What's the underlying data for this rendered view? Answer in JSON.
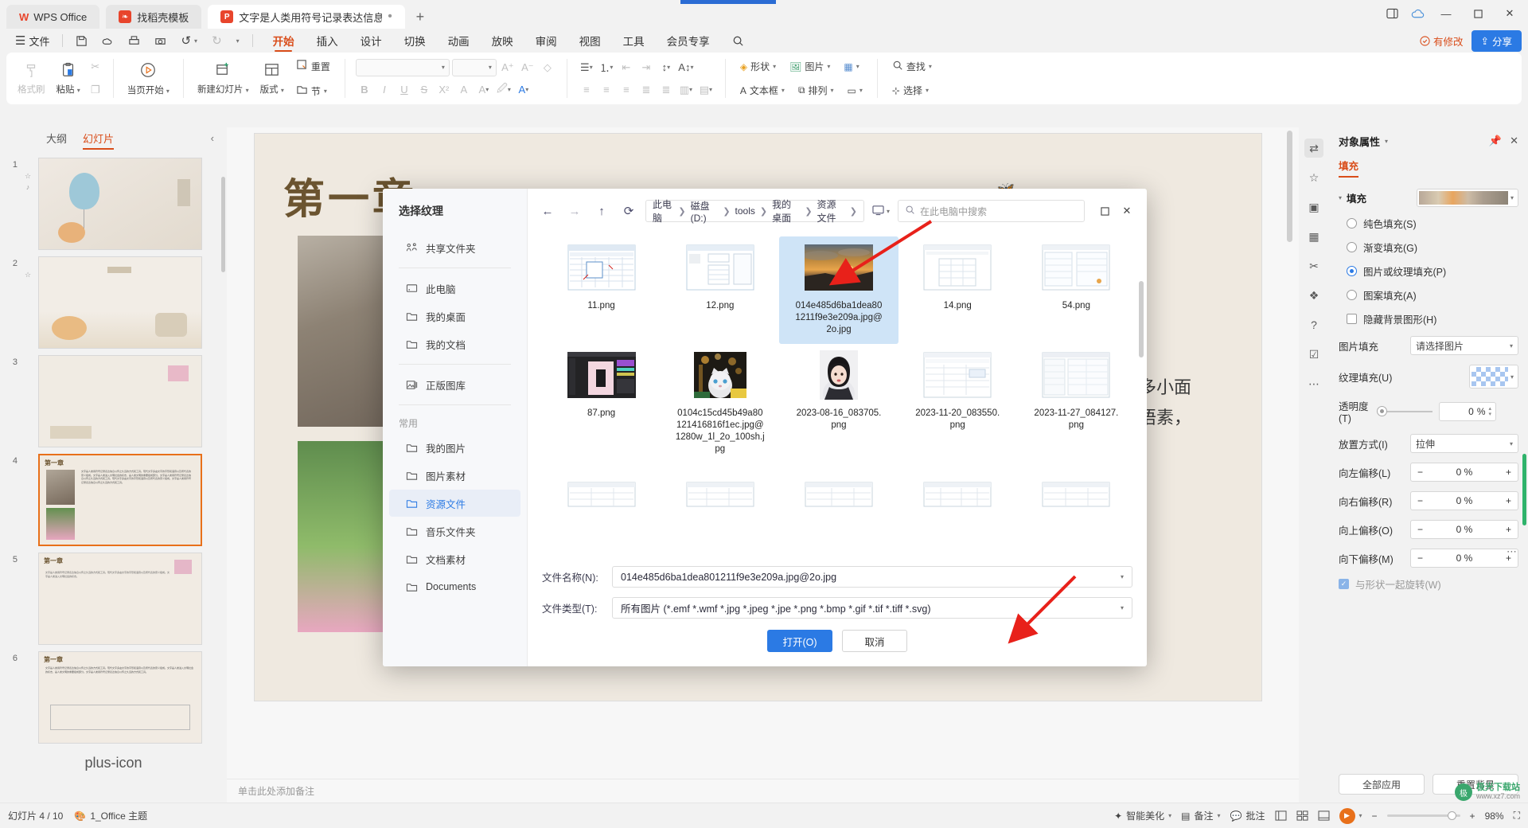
{
  "titlebar": {
    "tabs": [
      {
        "label": "WPS Office",
        "icon": "wps-logo-icon",
        "active": false
      },
      {
        "label": "找稻壳模板",
        "icon": "daoke-icon",
        "active": false
      },
      {
        "label": "文字是人类用符号记录表达信息以…",
        "icon": "ppt-file-icon",
        "active": true
      }
    ],
    "new_tab": "+",
    "window_controls": {
      "minimize": "—",
      "maximize": "▢",
      "close": "✕",
      "sidebar": "▤",
      "cloud": "☁"
    }
  },
  "menubar": {
    "file_label": "文件",
    "quick_icons": [
      "save-icon",
      "cloud-save-icon",
      "print-icon",
      "print-preview-icon",
      "undo-icon",
      "redo-icon",
      "customize-icon"
    ],
    "tabs": [
      {
        "label": "开始",
        "active": true
      },
      {
        "label": "插入",
        "active": false
      },
      {
        "label": "设计",
        "active": false
      },
      {
        "label": "切换",
        "active": false
      },
      {
        "label": "动画",
        "active": false
      },
      {
        "label": "放映",
        "active": false
      },
      {
        "label": "审阅",
        "active": false
      },
      {
        "label": "视图",
        "active": false
      },
      {
        "label": "工具",
        "active": false
      },
      {
        "label": "会员专享",
        "active": false
      }
    ],
    "search_icon": "search-icon",
    "modified_status": "有修改",
    "share_label": "分享"
  },
  "ribbon": {
    "clipboard": [
      {
        "label": "格式刷",
        "icon": "format-painter-icon",
        "dim": true
      },
      {
        "label": "粘贴",
        "icon": "paste-icon",
        "dim": false,
        "caret": true
      },
      {
        "label": "",
        "icon": "cut-icon",
        "dim": true
      },
      {
        "label": "",
        "icon": "copy-icon",
        "dim": true
      }
    ],
    "present": {
      "label": "当页开始",
      "icon": "play-circle-icon",
      "caret": true
    },
    "slides": [
      {
        "label": "新建幻灯片",
        "icon": "new-slide-icon",
        "caret": true
      },
      {
        "label": "版式",
        "icon": "layout-icon",
        "caret": true
      },
      {
        "label": "节",
        "icon": "section-icon",
        "caret": true
      },
      {
        "label": "重置",
        "icon": "reset-icon",
        "caret": false
      }
    ],
    "font": {
      "family_value": "",
      "size_value": "",
      "grow_icon": "font-grow-icon",
      "shrink_icon": "font-shrink-icon",
      "clear_icon": "clear-format-icon",
      "bold": "B",
      "italic": "I",
      "underline": "U",
      "strike": "S",
      "superscript": "X²",
      "shadow": "A",
      "text_color_icon": "font-color-icon",
      "highlight_icon": "highlight-icon",
      "char_effect_icon": "char-effect-icon"
    },
    "paragraph": {
      "bullets_icon": "bullet-list-icon",
      "numbering_icon": "numbered-list-icon",
      "indent_dec_icon": "decrease-indent-icon",
      "indent_inc_icon": "increase-indent-icon",
      "line_space_icon": "line-spacing-icon",
      "text_dir_icon": "text-direction-icon",
      "align_left_icon": "align-left-icon",
      "align_center_icon": "align-center-icon",
      "align_right_icon": "align-right-icon",
      "align_justify_icon": "align-justify-icon",
      "align_distribute_icon": "align-distribute-icon",
      "columns_icon": "columns-icon",
      "align_vertical_icon": "align-vertical-icon"
    },
    "drawing": [
      {
        "label": "形状",
        "icon": "shapes-icon",
        "caret": true
      },
      {
        "label": "图片",
        "icon": "picture-icon",
        "caret": true
      },
      {
        "label": "",
        "icon": "smartart-icon",
        "caret": true
      },
      {
        "label": "文本框",
        "icon": "textbox-icon",
        "caret": true
      },
      {
        "label": "排列",
        "icon": "arrange-icon",
        "caret": true
      },
      {
        "label": "",
        "icon": "quickstyle-icon",
        "caret": true
      }
    ],
    "editing": [
      {
        "label": "查找",
        "icon": "find-icon",
        "caret": true
      },
      {
        "label": "选择",
        "icon": "select-icon",
        "caret": true
      }
    ]
  },
  "slidepanel": {
    "tabs": [
      {
        "label": "大纲",
        "active": false
      },
      {
        "label": "幻灯片",
        "active": true
      }
    ],
    "collapse_icon": "chevron-left-icon",
    "add_slide_icon": "plus-icon",
    "slides": [
      {
        "number": "1",
        "selected": false,
        "title": ""
      },
      {
        "number": "2",
        "selected": false,
        "title": ""
      },
      {
        "number": "3",
        "selected": false,
        "title": ""
      },
      {
        "number": "4",
        "selected": true,
        "title": "第一章"
      },
      {
        "number": "5",
        "selected": false,
        "title": "第一章"
      },
      {
        "number": "6",
        "selected": false,
        "title": "第一章"
      }
    ]
  },
  "canvas": {
    "heading": "第一章",
    "body_text": "文字大多小面表依文语素，"
  },
  "notes_placeholder": "单击此处添加备注",
  "dialog": {
    "title": "选择纹理",
    "nav": {
      "top": [
        {
          "label": "共享文件夹",
          "icon": "share-folder-icon",
          "active": false
        }
      ],
      "places": [
        {
          "label": "此电脑",
          "icon": "computer-icon",
          "active": false
        },
        {
          "label": "我的桌面",
          "icon": "folder-icon",
          "active": false
        },
        {
          "label": "我的文档",
          "icon": "folder-icon",
          "active": false
        }
      ],
      "stock": [
        {
          "label": "正版图库",
          "icon": "stock-image-icon",
          "active": false
        }
      ],
      "common_label": "常用",
      "common": [
        {
          "label": "我的图片",
          "icon": "folder-icon",
          "active": false
        },
        {
          "label": "图片素材",
          "icon": "folder-icon",
          "active": false
        },
        {
          "label": "资源文件",
          "icon": "folder-icon",
          "active": true
        },
        {
          "label": "音乐文件夹",
          "icon": "folder-icon",
          "active": false
        },
        {
          "label": "文档素材",
          "icon": "folder-icon",
          "active": false
        },
        {
          "label": "Documents",
          "icon": "folder-icon",
          "active": false
        }
      ]
    },
    "toolbar": {
      "back_icon": "arrow-left-icon",
      "forward_icon": "arrow-right-icon",
      "up_icon": "arrow-up-icon",
      "refresh_icon": "refresh-icon",
      "view_icon": "view-mode-icon",
      "search_icon": "search-icon",
      "search_placeholder": "在此电脑中搜索",
      "maximize_icon": "maximize-icon",
      "close_icon": "close-icon",
      "breadcrumb": [
        "此电脑",
        "磁盘 (D:)",
        "tools",
        "我的桌面",
        "资源文件"
      ]
    },
    "files": [
      {
        "name": "11.png",
        "type": "screenshot-excel",
        "selected": false
      },
      {
        "name": "12.png",
        "type": "screenshot-doc",
        "selected": false
      },
      {
        "name": "014e485d6ba1dea801211f9e3e209a.jpg@2o.jpg",
        "type": "photo-sunset",
        "selected": true
      },
      {
        "name": "14.png",
        "type": "screenshot-table",
        "selected": false
      },
      {
        "name": "54.png",
        "type": "screenshot-table2",
        "selected": false
      },
      {
        "name": "87.png",
        "type": "screenshot-dark",
        "selected": false
      },
      {
        "name": "0104c15cd45b49a80121416816f1ec.jpg@1280w_1l_2o_100sh.jpg",
        "type": "photo-cat",
        "selected": false
      },
      {
        "name": "2023-08-16_083705.png",
        "type": "photo-portrait",
        "selected": false
      },
      {
        "name": "2023-11-20_083550.png",
        "type": "screenshot-light",
        "selected": false
      },
      {
        "name": "2023-11-27_084127.png",
        "type": "screenshot-light2",
        "selected": false
      },
      {
        "name": "",
        "type": "screenshot-row3a",
        "selected": false
      },
      {
        "name": "",
        "type": "screenshot-row3b",
        "selected": false
      },
      {
        "name": "",
        "type": "screenshot-row3c",
        "selected": false
      },
      {
        "name": "",
        "type": "screenshot-row3d",
        "selected": false
      },
      {
        "name": "",
        "type": "screenshot-row3e",
        "selected": false
      }
    ],
    "form": {
      "filename_label": "文件名称(N):",
      "filename_value": "014e485d6ba1dea801211f9e3e209a.jpg@2o.jpg",
      "filetype_label": "文件类型(T):",
      "filetype_value": "所有图片 (*.emf *.wmf *.jpg *.jpeg *.jpe *.png *.bmp *.gif *.tif *.tiff *.svg)",
      "open_button": "打开(O)",
      "cancel_button": "取消"
    }
  },
  "properties": {
    "panel_title": "对象属性",
    "panel_caret": "chevron-down-icon",
    "pin_icon": "pin-icon",
    "close_icon": "close-icon",
    "section_tab": "填充",
    "fill_group_label": "填充",
    "fill_options": [
      {
        "label": "纯色填充(S)",
        "selected": false
      },
      {
        "label": "渐变填充(G)",
        "selected": false
      },
      {
        "label": "图片或纹理填充(P)",
        "selected": true
      },
      {
        "label": "图案填充(A)",
        "selected": false
      }
    ],
    "hide_bg_label": "隐藏背景图形(H)",
    "hide_bg_checked": false,
    "picture_fill_label": "图片填充",
    "picture_fill_value": "请选择图片",
    "texture_fill_label": "纹理填充(U)",
    "transparency_label": "透明度(T)",
    "transparency_value": "0",
    "transparency_unit": "%",
    "placement_label": "放置方式(I)",
    "placement_value": "拉伸",
    "offsets": [
      {
        "label": "向左偏移(L)",
        "value": "0",
        "unit": "%"
      },
      {
        "label": "向右偏移(R)",
        "value": "0",
        "unit": "%"
      },
      {
        "label": "向上偏移(O)",
        "value": "0",
        "unit": "%"
      },
      {
        "label": "向下偏移(M)",
        "value": "0",
        "unit": "%"
      }
    ],
    "rotate_with_shape_label": "与形状一起旋转(W)",
    "rotate_with_shape_checked": true,
    "apply_all_button": "全部应用",
    "reset_bg_button": "重置背景",
    "more_icon": "more-dots-icon"
  },
  "rightbar_icons": [
    "panel-toggle-icon",
    "star-icon",
    "image-panel-icon",
    "grid-panel-icon",
    "scissors-icon",
    "layers-icon",
    "help-icon",
    "feedback-icon",
    "more-dots-icon"
  ],
  "statusbar": {
    "slide_counter": "幻灯片 4 / 10",
    "theme_icon": "theme-icon",
    "theme_label": "1_Office 主题",
    "beautify_label": "智能美化",
    "notes_label": "备注",
    "comment_label": "批注",
    "view_icons": [
      "normal-view-icon",
      "sorter-view-icon",
      "reading-view-icon",
      "play-view-icon"
    ],
    "zoom_out": "−",
    "zoom_in": "+",
    "zoom_value": "98%",
    "fit_icon": "fit-screen-icon"
  },
  "watermark": {
    "line1": "极光下载站",
    "line2": "www.xz7.com"
  },
  "colors": {
    "accent_orange": "#d94d1a",
    "accent_blue": "#2b7ae4",
    "selection_blue": "#cfe4f7",
    "annotation_red": "#e8211a"
  }
}
